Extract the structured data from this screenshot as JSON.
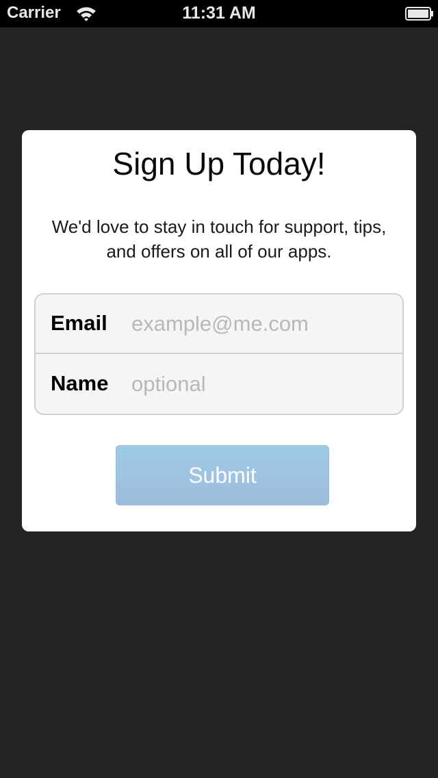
{
  "status_bar": {
    "carrier": "Carrier",
    "time": "11:31 AM",
    "wifi_icon": "wifi-icon",
    "battery_icon": "battery-icon"
  },
  "signup": {
    "title": "Sign Up Today!",
    "subtitle": "We'd love to stay in touch for support, tips, and offers on all of our apps.",
    "fields": [
      {
        "label": "Email",
        "value": "",
        "placeholder": "example@me.com"
      },
      {
        "label": "Name",
        "value": "",
        "placeholder": "optional"
      }
    ],
    "submit_label": "Submit"
  },
  "colors": {
    "background": "#232323",
    "status_bar": "#000000",
    "card": "#ffffff",
    "submit_button": "#9fc4e0"
  }
}
